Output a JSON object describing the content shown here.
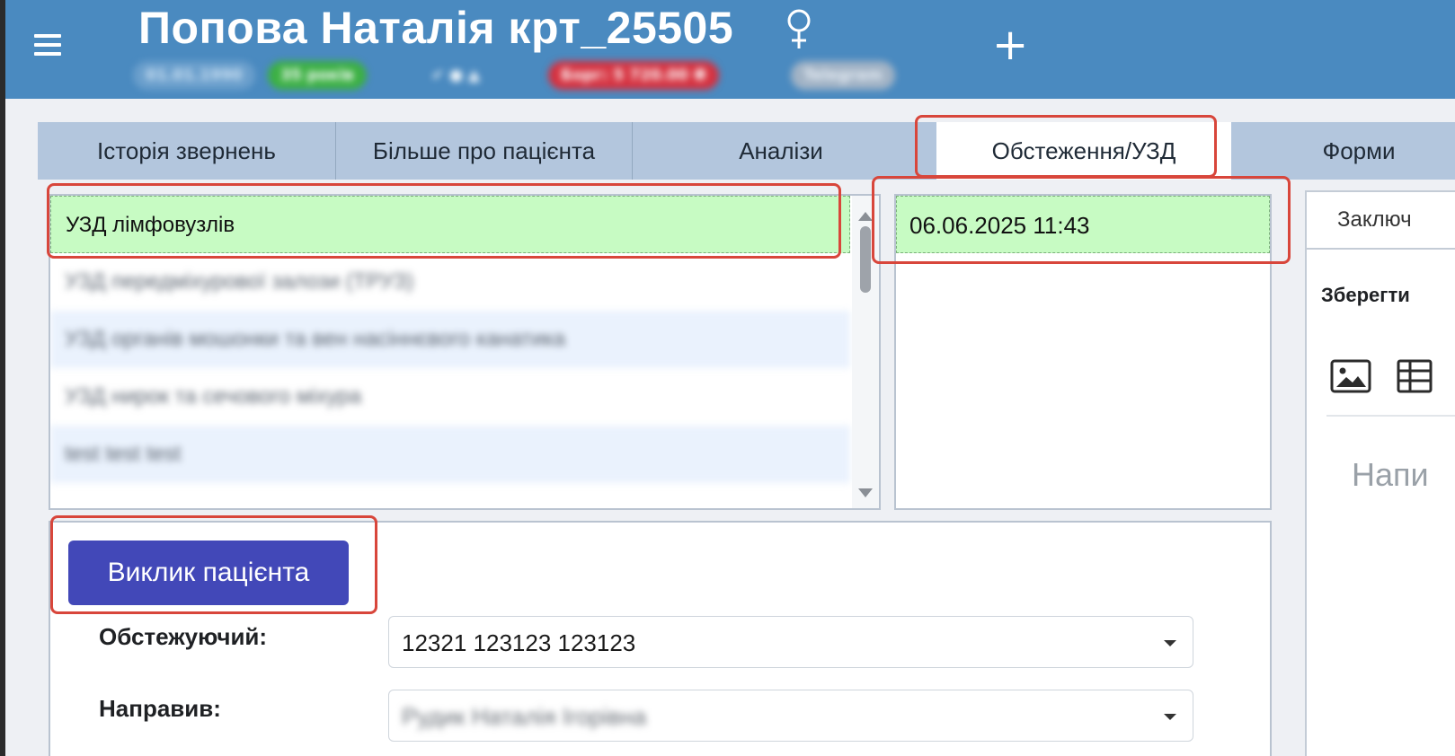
{
  "header": {
    "patient_title": "Попова Наталія крт_25505",
    "status": {
      "dob": "01.01.1990",
      "age": "35 років",
      "debt": "Борг: 5 720.00 ₴",
      "telegram": "Telegram"
    },
    "add_symbol": "+"
  },
  "tabs": [
    {
      "label": "Історія звернень"
    },
    {
      "label": "Більше про пацієнта"
    },
    {
      "label": "Аналізи"
    },
    {
      "label": "Обстеження/УЗД",
      "active": true
    },
    {
      "label": "Форми"
    }
  ],
  "exam_list": {
    "items": [
      {
        "label": "УЗД лімфовузлів",
        "selected": true
      },
      {
        "label": "УЗД передміхурової залози (ТРУЗ)"
      },
      {
        "label": "УЗД органів мошонки та вен насіннєвого канатика"
      },
      {
        "label": "УЗД нирок та сечового міхура"
      },
      {
        "label": "test test test"
      }
    ]
  },
  "date_list": {
    "items": [
      {
        "label": "06.06.2025 11:43",
        "selected": true
      }
    ]
  },
  "form": {
    "call_patient_label": "Виклик пацієнта",
    "examiner_label": "Обстежуючий:",
    "examiner_value": "12321 123123 123123",
    "referrer_label": "Направив:",
    "referrer_value": "Рудик Наталія Ігорівна"
  },
  "right_panel": {
    "tab_label": "Заключ",
    "save_label": "Зберегти",
    "editor_placeholder": "Напи"
  },
  "colors": {
    "header_bg": "#4a8ac0",
    "selected_row_bg": "#c7fbc3",
    "primary_button": "#4248b8",
    "highlight": "#d8463b"
  }
}
